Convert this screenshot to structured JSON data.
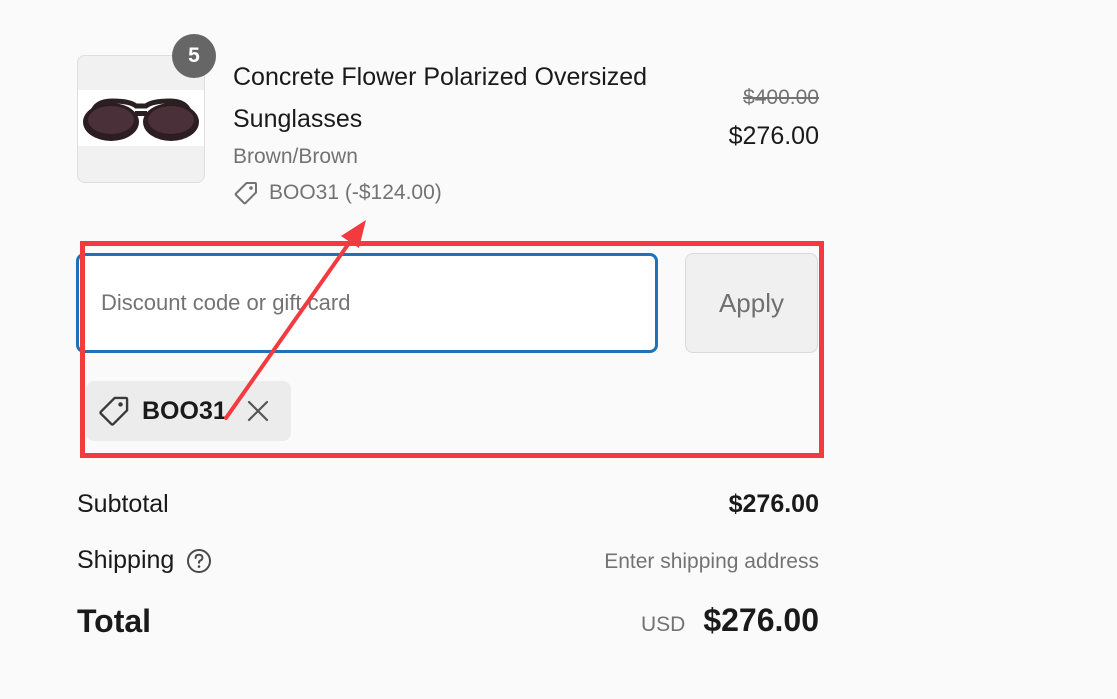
{
  "cart": {
    "item": {
      "quantity": "5",
      "name": "Concrete Flower Polarized Oversized Sunglasses",
      "variant": "Brown/Brown",
      "discount_line": "BOO31 (-$124.00)",
      "original_price": "$400.00",
      "price": "$276.00",
      "image_icon": "sunglasses-product-image"
    }
  },
  "discount": {
    "placeholder": "Discount code or gift card",
    "value": "",
    "apply_label": "Apply",
    "applied_code": "BOO31",
    "tag_icon": "tag-icon",
    "remove_icon": "close-icon"
  },
  "summary": {
    "subtotal_label": "Subtotal",
    "subtotal_value": "$276.00",
    "shipping_label": "Shipping",
    "shipping_help_icon": "question-circle-icon",
    "shipping_value": "Enter shipping address",
    "total_label": "Total",
    "total_currency": "USD",
    "total_value": "$276.00"
  },
  "annotation": {
    "highlight_color": "#f23a3f"
  },
  "colors": {
    "input_focus_border": "#1f72b8",
    "muted_text": "#737373",
    "badge_bg": "#666666"
  }
}
